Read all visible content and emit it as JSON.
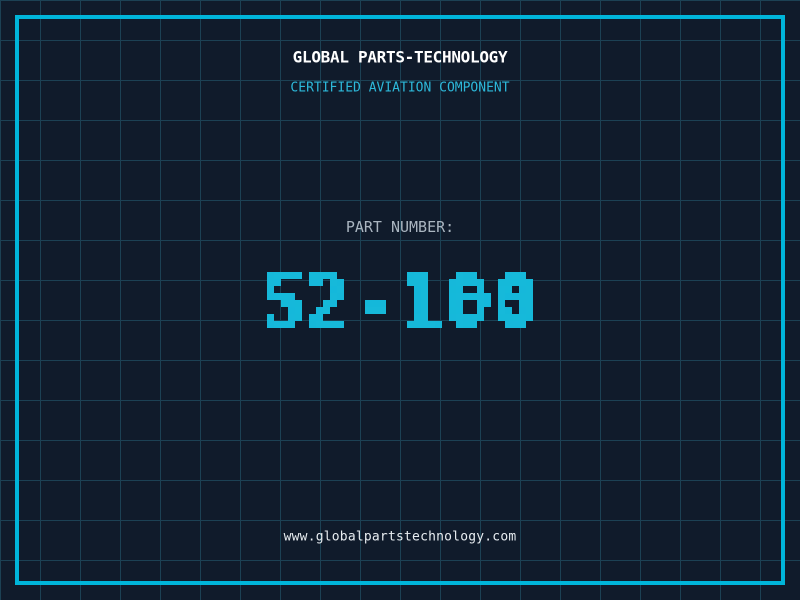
{
  "page": {
    "background_color": "#101b2b",
    "grid_color": "#1c4154",
    "frame_color": "#00b5da"
  },
  "header": {
    "title": "GLOBAL PARTS-TECHNOLOGY",
    "title_color": "#ffffff",
    "subtitle": "CERTIFIED AVIATION COMPONENT",
    "subtitle_color": "#2db9da"
  },
  "part": {
    "label": "PART NUMBER:",
    "label_color": "#aab5c0",
    "number": "52-100",
    "number_color": "#16b9da"
  },
  "footer": {
    "website": "www.globalpartstechnology.com",
    "website_color": "#e8edf1"
  }
}
